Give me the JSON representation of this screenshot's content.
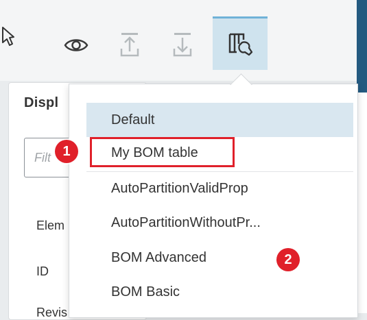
{
  "toolbar": {
    "buttons": [
      {
        "icon": "eye-icon"
      },
      {
        "icon": "upload-icon"
      },
      {
        "icon": "download-icon"
      },
      {
        "icon": "table-settings-icon",
        "active": true
      }
    ]
  },
  "panel": {
    "title": "Displ",
    "filter_placeholder": "Filt",
    "labels": [
      "Elem",
      "ID",
      "Revis"
    ]
  },
  "dropdown": {
    "items": [
      {
        "label": "Default",
        "selected": true
      },
      {
        "label": "My BOM table"
      },
      {
        "label": "AutoPartitionValidProp"
      },
      {
        "label": "AutoPartitionWithoutPr..."
      },
      {
        "label": "BOM Advanced"
      },
      {
        "label": "BOM Basic"
      }
    ]
  },
  "annotations": {
    "badge_1": "1",
    "badge_2": "2"
  },
  "colors": {
    "accent": "#245a80",
    "selected_bg": "#d9e7f0",
    "highlight": "#e0202a"
  }
}
